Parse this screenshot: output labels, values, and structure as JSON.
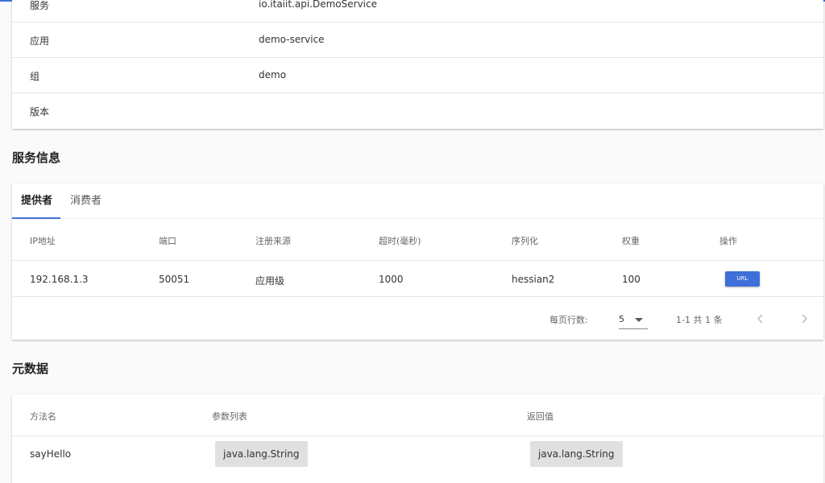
{
  "basic_info": {
    "rows": [
      {
        "label": "服务",
        "value": "io.itaiit.api.DemoService"
      },
      {
        "label": "应用",
        "value": "demo-service"
      },
      {
        "label": "组",
        "value": "demo"
      },
      {
        "label": "版本",
        "value": ""
      }
    ]
  },
  "service_info": {
    "title": "服务信息",
    "tabs": [
      {
        "label": "提供者",
        "active": true
      },
      {
        "label": "消费者",
        "active": false
      }
    ],
    "columns": [
      "IP地址",
      "端口",
      "注册来源",
      "超时(毫秒)",
      "序列化",
      "权重",
      "操作"
    ],
    "rows": [
      {
        "ip": "192.168.1.3",
        "port": "50051",
        "source": "应用级",
        "timeout": "1000",
        "serialization": "hessian2",
        "weight": "100",
        "action": "URL"
      }
    ],
    "pagination": {
      "rows_per_page_label": "每页行数:",
      "rows_per_page": "5",
      "range": "1-1 共 1 条"
    }
  },
  "metadata": {
    "title": "元数据",
    "columns": [
      "方法名",
      "参数列表",
      "返回值"
    ],
    "rows": [
      {
        "method": "sayHello",
        "params": "java.lang.String",
        "returns": "java.lang.String"
      }
    ]
  },
  "colors": {
    "accent": "#3f6fd8"
  }
}
